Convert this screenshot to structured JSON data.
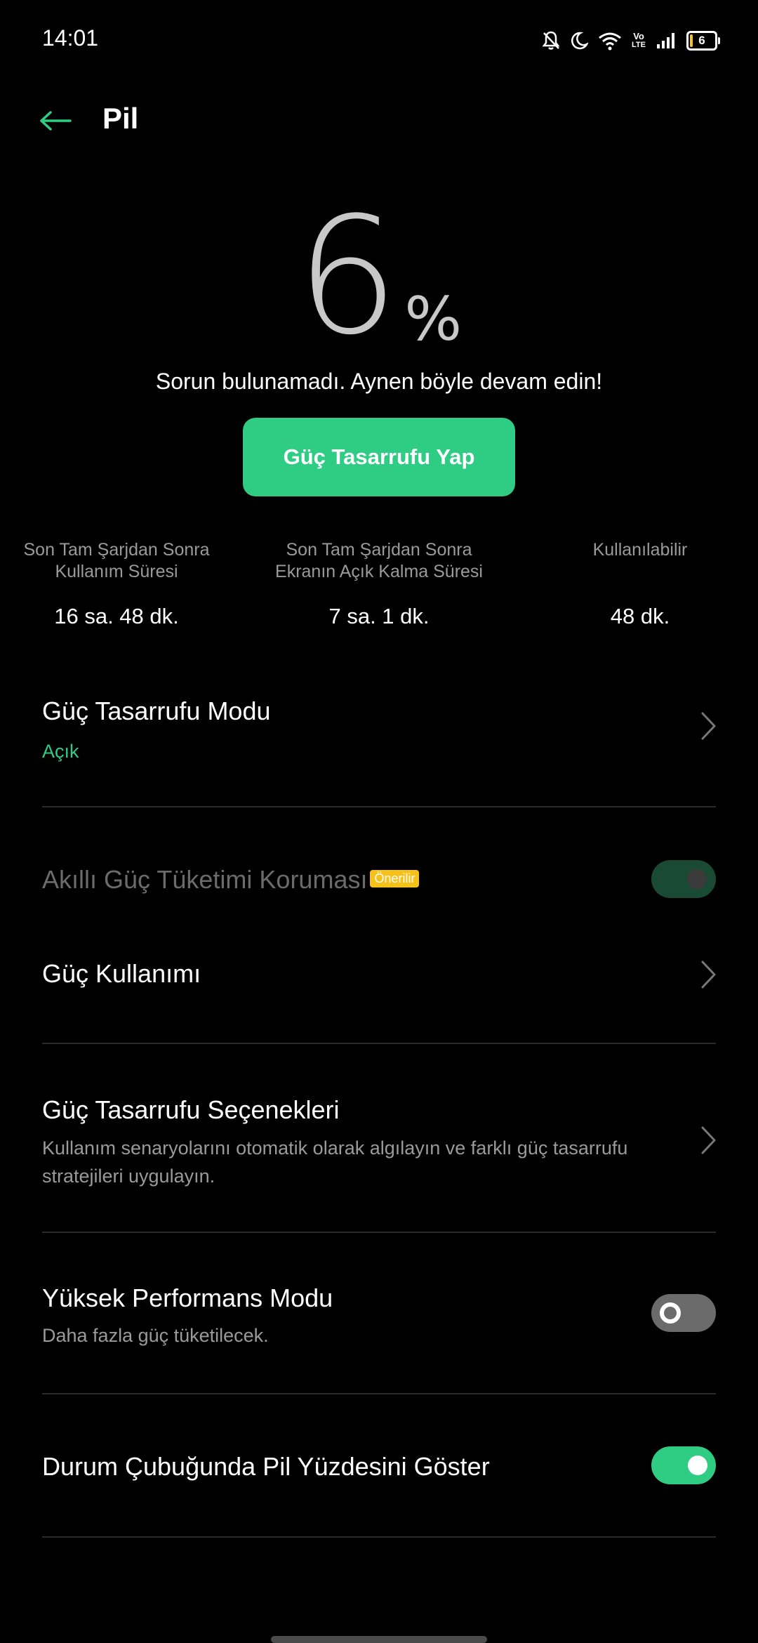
{
  "status_bar": {
    "time": "14:01",
    "icons": [
      "bell-off-icon",
      "moon-icon",
      "wifi-icon",
      "volte-icon",
      "signal-icon",
      "battery-icon"
    ],
    "battery_text": "6",
    "volte_top": "Vo",
    "volte_bottom": "LTE"
  },
  "header": {
    "title": "Pil",
    "back_icon": "arrow-left-icon"
  },
  "battery": {
    "percent_value": "6",
    "percent_sign": "%",
    "message": "Sorun bulunamadı. Aynen böyle devam edin!",
    "save_button_label": "Güç Tasarrufu Yap"
  },
  "stats": [
    {
      "label_line1": "Son Tam Şarjdan Sonra",
      "label_line2": "Kullanım Süresi",
      "value": "16 sa. 48 dk."
    },
    {
      "label_line1": "Son Tam Şarjdan Sonra",
      "label_line2": "Ekranın Açık Kalma Süresi",
      "value": "7 sa. 1 dk."
    },
    {
      "label_line1": "Kullanılabilir",
      "label_line2": "",
      "value": "48 dk."
    }
  ],
  "settings": {
    "power_saving_mode": {
      "title": "Güç Tasarrufu Modu",
      "status": "Açık"
    },
    "smart_power": {
      "title": "Akıllı Güç Tüketimi Koruması",
      "badge": "Önerilir",
      "enabled": true,
      "disabled": true
    },
    "power_usage": {
      "title": "Güç Kullanımı"
    },
    "power_saving_options": {
      "title": "Güç Tasarrufu Seçenekleri",
      "description_line1": "Kullanım senaryolarını otomatik olarak algılayın ve farklı güç tasarrufu",
      "description_line2": "stratejileri uygulayın."
    },
    "high_performance": {
      "title": "Yüksek Performans Modu",
      "description": "Daha fazla güç tüketilecek.",
      "enabled": false
    },
    "show_battery_percent": {
      "title": "Durum Çubuğunda Pil Yüzdesini Göster",
      "enabled": true
    }
  },
  "colors": {
    "accent": "#2fcc84",
    "background": "#000000",
    "badge": "#f6c21a"
  }
}
